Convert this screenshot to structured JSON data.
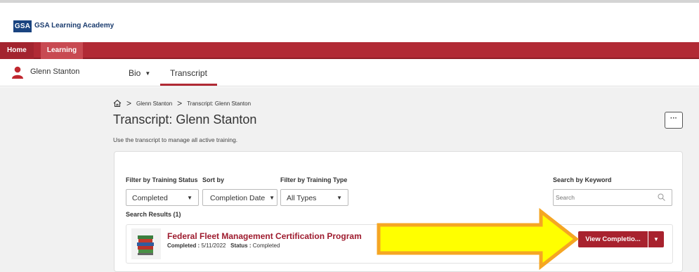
{
  "brand": {
    "logo_text": "GSA",
    "name": "GSA Learning Academy"
  },
  "nav": {
    "home": "Home",
    "learning": "Learning"
  },
  "user": {
    "name": "Glenn Stanton"
  },
  "tabs": {
    "bio": "Bio",
    "bio_caret": "▼",
    "transcript": "Transcript"
  },
  "breadcrumb": {
    "sep": ">",
    "items": [
      "Glenn Stanton",
      "Transcript: Glenn Stanton"
    ]
  },
  "page": {
    "title": "Transcript: Glenn Stanton",
    "description": "Use the transcript to manage all active training.",
    "more_label": "···"
  },
  "filters": {
    "status_label": "Filter by Training Status",
    "status_value": "Completed",
    "sort_label": "Sort by",
    "sort_value": "Completion Date",
    "type_label": "Filter by Training Type",
    "type_value": "All Types",
    "caret": "▼",
    "keyword_label": "Search by Keyword",
    "keyword_placeholder": "Search"
  },
  "results": {
    "label": "Search Results (1)",
    "items": [
      {
        "title": "Federal Fleet Management Certification Program",
        "completed_label": "Completed :",
        "completed_date": "5/11/2022",
        "status_label": "Status :",
        "status_value": "Completed",
        "action_label": "View Completio...",
        "action_caret": "▼"
      }
    ]
  },
  "colors": {
    "brand_red": "#b12a35",
    "button_red": "#a8222e",
    "title_red": "#9e1b2e",
    "logo_blue": "#1a4480",
    "arrow_fill": "#ffff00",
    "arrow_stroke": "#f5a623"
  }
}
